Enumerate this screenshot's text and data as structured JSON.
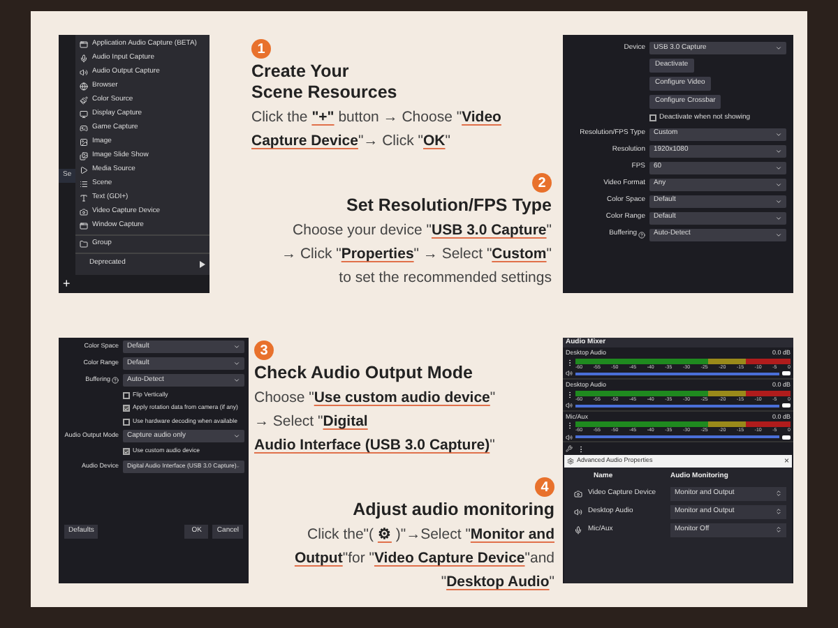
{
  "source_panel": {
    "background_label": "Se",
    "add_button": "+",
    "menu": [
      {
        "label": "Application Audio Capture (BETA)",
        "kind": "item"
      },
      {
        "label": "Audio Input Capture",
        "kind": "item"
      },
      {
        "label": "Audio Output Capture",
        "kind": "item"
      },
      {
        "label": "Browser",
        "kind": "item"
      },
      {
        "label": "Color Source",
        "kind": "item"
      },
      {
        "label": "Display Capture",
        "kind": "item"
      },
      {
        "label": "Game Capture",
        "kind": "item"
      },
      {
        "label": "Image",
        "kind": "item"
      },
      {
        "label": "Image Slide Show",
        "kind": "item"
      },
      {
        "label": "Media Source",
        "kind": "item"
      },
      {
        "label": "Scene",
        "kind": "item"
      },
      {
        "label": "Text (GDI+)",
        "kind": "item"
      },
      {
        "label": "Video Capture Device",
        "kind": "item"
      },
      {
        "label": "Window Capture",
        "kind": "item"
      },
      {
        "label": "Group",
        "kind": "separated"
      },
      {
        "label": "Deprecated",
        "kind": "submenu"
      }
    ]
  },
  "steps": [
    {
      "number": "1",
      "title": "Create Your\nScene Resources",
      "body": "Click the **\"+\"** button → Choose \"**Video**\n**Capture Device**\"→ Click \"**OK**\""
    },
    {
      "number": "2",
      "title": "Set Resolution/FPS Type",
      "body": "Choose your device \"**USB 3.0 Capture**\"\n→ Click \"**Properties**\" → Select \"**Custom**\"\nto set the recommended settings"
    },
    {
      "number": "3",
      "title": "Check Audio Output Mode",
      "body": "Choose \"**Use custom audio device**\"\n→ Select \"**Digital**\n**Audio Interface (USB 3.0 Capture)**\""
    },
    {
      "number": "4",
      "title": "Adjust audio monitoring",
      "body": "Click the\"( **⚙** )\"→Select  \"**Monitor and**\n**Output**\"for \"**Video Capture Device**\"and\n\"**Desktop Audio**\""
    }
  ],
  "properties_top": {
    "device": {
      "label": "Device",
      "value": "USB 3.0 Capture"
    },
    "buttons": [
      "Deactivate",
      "Configure Video",
      "Configure Crossbar"
    ],
    "deactivate_checkbox": {
      "label": "Deactivate when not showing",
      "checked": false
    },
    "fields": [
      {
        "label": "Resolution/FPS Type",
        "value": "Custom"
      },
      {
        "label": "Resolution",
        "value": "1920x1080"
      },
      {
        "label": "FPS",
        "value": "60"
      },
      {
        "label": "Video Format",
        "value": "Any"
      },
      {
        "label": "Color Space",
        "value": "Default"
      },
      {
        "label": "Color Range",
        "value": "Default"
      },
      {
        "label": "Buffering",
        "value": "Auto-Detect",
        "help": true
      }
    ]
  },
  "properties_bottom": {
    "fields": [
      {
        "label": "Color Space",
        "value": "Default"
      },
      {
        "label": "Color Range",
        "value": "Default"
      },
      {
        "label": "Buffering",
        "value": "Auto-Detect",
        "help": true
      }
    ],
    "checkboxes": [
      {
        "label": "Flip Vertically",
        "checked": false
      },
      {
        "label": "Apply rotation data from camera (if any)",
        "checked": true
      },
      {
        "label": "Use hardware decoding when available",
        "checked": false
      }
    ],
    "output_mode": {
      "label": "Audio Output Mode",
      "value": "Capture audio only"
    },
    "custom_audio": {
      "label": "Use custom audio device",
      "checked": true
    },
    "audio_device": {
      "label": "Audio Device",
      "value": "Digital Audio Interface (USB 3.0 Capture)"
    },
    "defaults_button": "Defaults",
    "ok_button": "OK",
    "cancel_button": "Cancel"
  },
  "audio_mixer": {
    "title": "Audio Mixer",
    "channels": [
      {
        "name": "Desktop Audio",
        "reading": "0.0 dB",
        "level": 1,
        "scale": [
          "-60",
          "-55",
          "-50",
          "-45",
          "-40",
          "-35",
          "-30",
          "-25",
          "-20",
          "-15",
          "-10",
          "-5",
          "0"
        ]
      },
      {
        "name": "Desktop Audio",
        "reading": "0.0 dB",
        "level": 1,
        "scale": [
          "-60",
          "-55",
          "-50",
          "-45",
          "-40",
          "-35",
          "-30",
          "-25",
          "-20",
          "-15",
          "-10",
          "-5",
          "0"
        ]
      },
      {
        "name": "Mic/Aux",
        "reading": "0.0 dB",
        "level": 1,
        "scale": [
          "-60",
          "-55",
          "-50",
          "-45",
          "-40",
          "-35",
          "-30",
          "-25",
          "-20",
          "-15",
          "-10",
          "-5",
          "0"
        ]
      }
    ]
  },
  "advanced_audio": {
    "title": "Advanced Audio Properties",
    "close": "×",
    "columns": [
      "Name",
      "Audio Monitoring"
    ],
    "rows": [
      {
        "name": "Video Capture Device",
        "monitoring": "Monitor and Output"
      },
      {
        "name": "Desktop Audio",
        "monitoring": "Monitor and Output"
      },
      {
        "name": "Mic/Aux",
        "monitoring": "Monitor Off"
      }
    ]
  }
}
